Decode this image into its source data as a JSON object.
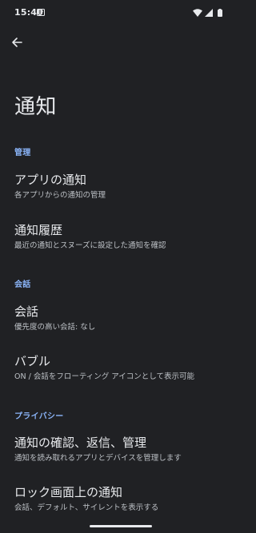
{
  "status_bar": {
    "time": "15:40",
    "icons": [
      "notification-icon",
      "wifi-icon",
      "signal-icon",
      "battery-icon"
    ]
  },
  "header": {
    "back_icon": "arrow-back-icon",
    "title": "通知"
  },
  "sections": {
    "manage": {
      "header": "管理",
      "app_notifications": {
        "title": "アプリの通知",
        "subtitle": "各アプリからの通知の管理"
      },
      "notification_history": {
        "title": "通知履歴",
        "subtitle": "最近の通知とスヌーズに設定した通知を確認"
      }
    },
    "conversation": {
      "header": "会話",
      "conversations": {
        "title": "会話",
        "subtitle": "優先度の高い会話: なし"
      },
      "bubbles": {
        "title": "バブル",
        "subtitle": "ON / 会話をフローティング アイコンとして表示可能"
      }
    },
    "privacy": {
      "header": "プライバシー",
      "notification_access": {
        "title": "通知の確認、返信、管理",
        "subtitle": "通知を読み取れるアプリとデバイスを管理します"
      },
      "lock_screen": {
        "title": "ロック画面上の通知",
        "subtitle": "会話、デフォルト、サイレントを表示する"
      }
    }
  },
  "colors": {
    "background": "#202124",
    "accent": "#8ab4f8",
    "text_primary": "#e8eaed",
    "text_secondary": "#bdc1c6"
  }
}
